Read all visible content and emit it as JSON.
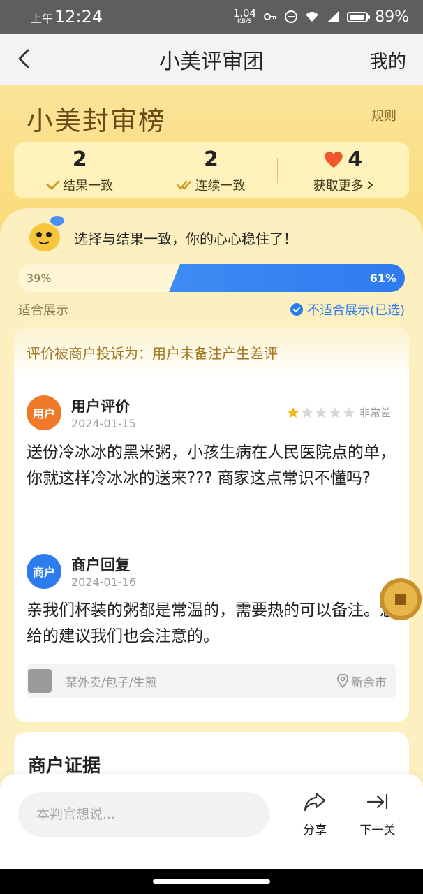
{
  "status_bar": {
    "ampm": "上午",
    "time": "12:24",
    "net_speed": "1.04",
    "net_unit": "KB/S",
    "battery": "89%"
  },
  "nav": {
    "title": "小美评审团",
    "mine_label": "我的"
  },
  "header": {
    "brand_title": "小美封审榜",
    "rules_label": "规则"
  },
  "stats": [
    {
      "value": "2",
      "label": "结果一致",
      "icon": "check-icon"
    },
    {
      "value": "2",
      "label": "连续一致",
      "icon": "double-check-icon"
    },
    {
      "value": "4",
      "label": "获取更多",
      "icon": "heart-icon"
    }
  ],
  "banner": {
    "message": "选择与结果一致，你的心心稳住了！"
  },
  "vote": {
    "left_percent": "39%",
    "right_percent": "61%",
    "left_fraction": 0.39,
    "right_fraction": 0.61,
    "left_option": "适合展示",
    "right_option": "不适合展示(已选)"
  },
  "review": {
    "complaint": "评价被商户投诉为：用户未备注产生差评",
    "user": {
      "badge": "用户",
      "name": "用户评价",
      "date": "2024-01-15",
      "rating": 1,
      "rating_max": 5,
      "rating_label": "非常差",
      "text": "送份冷冰冰的黑米粥，小孩生病在人民医院点的单，你就这样冷冰冰的送来???  商家这点常识不懂吗?"
    },
    "merchant": {
      "badge": "商户",
      "name": "商户回复",
      "date": "2024-01-16",
      "text": "亲我们杯装的粥都是常温的，需要热的可以备注。您给的建议我们也会注意的。"
    },
    "shop": {
      "category": "某外卖/包子/生煎",
      "location": "新余市"
    }
  },
  "evidence": {
    "title": "商户证据"
  },
  "bottom": {
    "input_placeholder": "本判官想说...",
    "share_label": "分享",
    "next_label": "下一关"
  },
  "colors": {
    "accent_blue": "#2e7bf0",
    "user_orange": "#f07a2a",
    "brand_brown": "#6b4a16",
    "heart_red": "#f0572a",
    "star_gold": "#f5b81c"
  }
}
